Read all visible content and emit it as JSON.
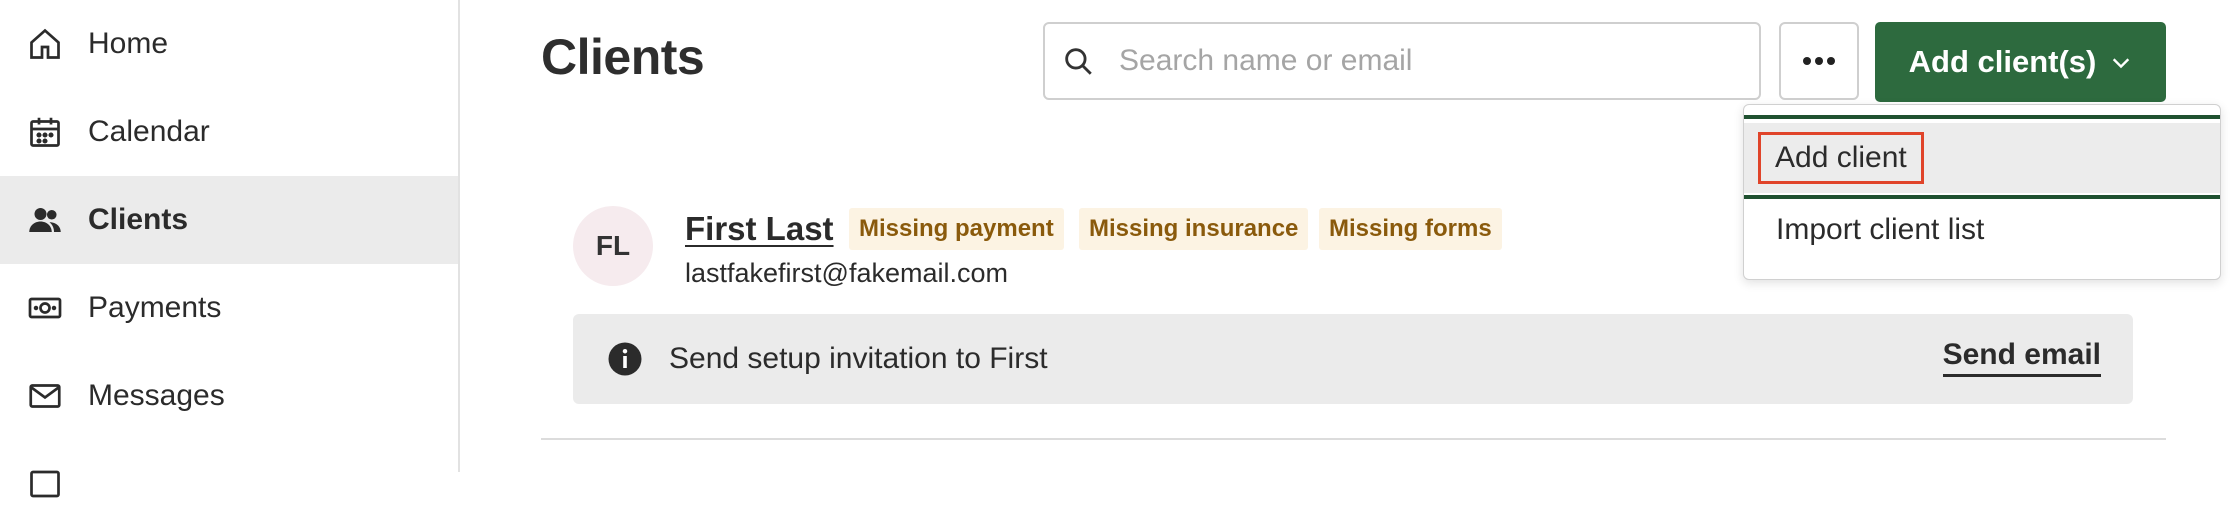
{
  "sidebar": {
    "items": [
      {
        "label": "Home",
        "icon": "home-icon"
      },
      {
        "label": "Calendar",
        "icon": "calendar-icon"
      },
      {
        "label": "Clients",
        "icon": "users-icon",
        "active": true
      },
      {
        "label": "Payments",
        "icon": "money-icon"
      },
      {
        "label": "Messages",
        "icon": "envelope-icon"
      }
    ]
  },
  "header": {
    "title": "Clients",
    "search_placeholder": "Search name or email",
    "more_button": "•••",
    "add_button_label": "Add client(s)"
  },
  "dropdown": {
    "items": [
      "Add client",
      "Import client list"
    ]
  },
  "client": {
    "initials": "FL",
    "name": "First Last",
    "email": "lastfakefirst@fakemail.com",
    "badges": [
      "Missing payment",
      "Missing insurance",
      "Missing forms"
    ],
    "invite_text": "Send setup invitation to First",
    "invite_action": "Send email"
  },
  "colors": {
    "accent": "#2d6a3e",
    "badge_bg": "#fcf3e3",
    "badge_text": "#8a5a0c",
    "highlight": "#e0442a"
  }
}
